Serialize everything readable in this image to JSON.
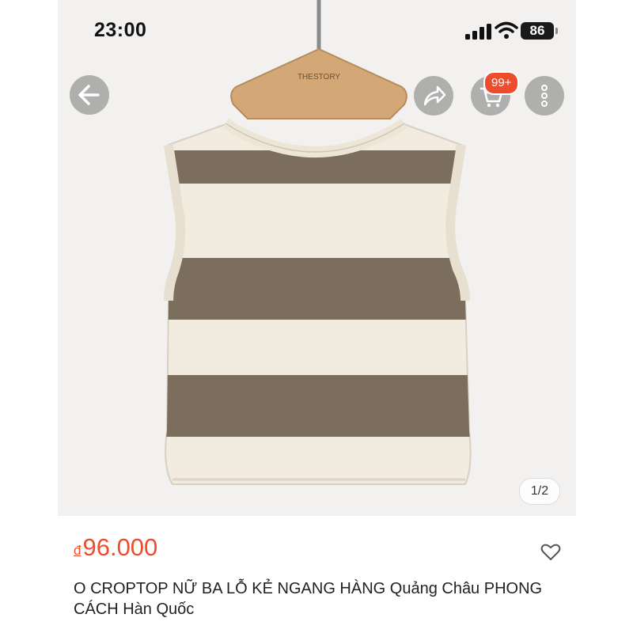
{
  "status_bar": {
    "time": "23:00",
    "battery": "86"
  },
  "header": {
    "back_icon": "arrow-left-icon",
    "share_icon": "share-icon",
    "cart_icon": "shopping-cart-icon",
    "cart_badge": "99+",
    "more_icon": "vertical-dots-icon"
  },
  "gallery": {
    "pager": "1/2",
    "hanger_label": "THESTORY"
  },
  "product": {
    "currency": "đ",
    "price": "96.000",
    "title": "O CROPTOP NỮ BA LỖ KẺ NGANG HÀNG Quảng Châu PHONG CÁCH Hàn Quốc"
  },
  "colors": {
    "accent": "#ee4d2d",
    "stripe_dark": "#7b6e5d",
    "stripe_light": "#f1ebe0"
  }
}
